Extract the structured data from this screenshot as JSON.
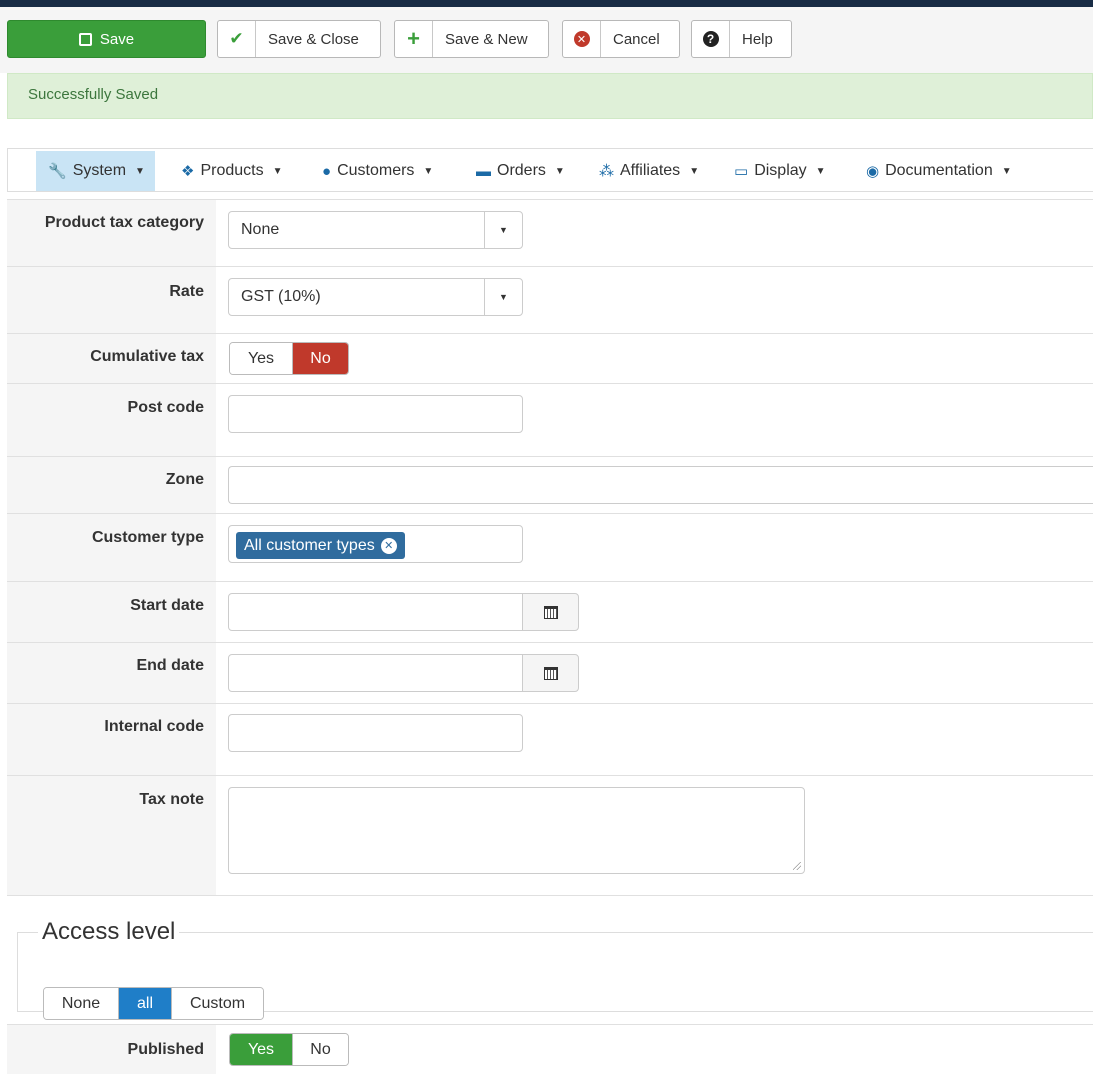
{
  "toolbar": {
    "save": "Save",
    "save_close": "Save & Close",
    "save_new": "Save & New",
    "cancel": "Cancel",
    "help": "Help"
  },
  "alert": {
    "message": "Successfully Saved"
  },
  "nav": {
    "items": [
      {
        "label": "System",
        "icon": "wrench-icon",
        "active": true
      },
      {
        "label": "Products",
        "icon": "cubes-icon"
      },
      {
        "label": "Customers",
        "icon": "user-icon"
      },
      {
        "label": "Orders",
        "icon": "credit-card-icon"
      },
      {
        "label": "Affiliates",
        "icon": "users-icon"
      },
      {
        "label": "Display",
        "icon": "monitor-icon"
      },
      {
        "label": "Documentation",
        "icon": "life-ring-icon"
      }
    ]
  },
  "form": {
    "product_tax_category": {
      "label": "Product tax category",
      "value": "None"
    },
    "rate": {
      "label": "Rate",
      "value": "GST (10%)"
    },
    "cumulative_tax": {
      "label": "Cumulative tax",
      "yes": "Yes",
      "no": "No",
      "selected": "No"
    },
    "post_code": {
      "label": "Post code",
      "value": ""
    },
    "zone": {
      "label": "Zone",
      "value": ""
    },
    "customer_type": {
      "label": "Customer type",
      "chip": "All customer types"
    },
    "start_date": {
      "label": "Start date",
      "value": ""
    },
    "end_date": {
      "label": "End date",
      "value": ""
    },
    "internal_code": {
      "label": "Internal code",
      "value": ""
    },
    "tax_note": {
      "label": "Tax note",
      "value": ""
    }
  },
  "access_level": {
    "legend": "Access level",
    "options": [
      "None",
      "all",
      "Custom"
    ],
    "selected": "all"
  },
  "published": {
    "label": "Published",
    "yes": "Yes",
    "no": "No",
    "selected": "Yes"
  },
  "colors": {
    "success": "#3a9e3a",
    "danger": "#c0392b",
    "primary": "#1f7ec8",
    "chip": "#306c9e"
  }
}
